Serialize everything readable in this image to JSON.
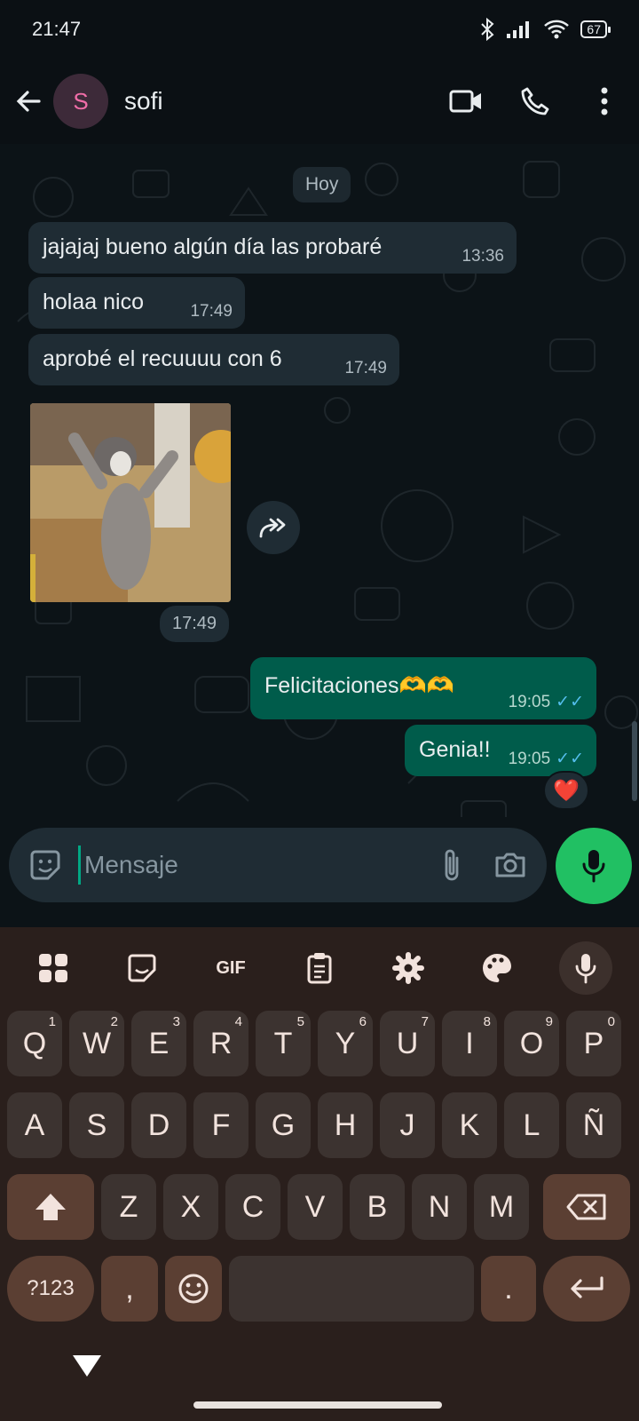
{
  "status": {
    "time": "21:47",
    "battery": "67"
  },
  "header": {
    "avatar_letter": "S",
    "contact_name": "sofi"
  },
  "chat": {
    "date_chip": "Hoy",
    "messages": [
      {
        "text": "jajajaj bueno algún día las probaré",
        "time": "13:36",
        "direction": "in"
      },
      {
        "text": "holaa nico",
        "time": "17:49",
        "direction": "in"
      },
      {
        "text": "aprobé el recuuuu con 6",
        "time": "17:49",
        "direction": "in"
      },
      {
        "type": "gif",
        "time": "17:49",
        "direction": "in"
      },
      {
        "text": "Felicitaciones🫶🫶",
        "time": "19:05",
        "direction": "out",
        "status": "read"
      },
      {
        "text": "Genia!!",
        "time": "19:05",
        "direction": "out",
        "status": "read",
        "reaction": "❤️"
      }
    ]
  },
  "composer": {
    "placeholder": "Mensaje"
  },
  "keyboard": {
    "toolbar": [
      "apps-icon",
      "sticker-icon",
      "GIF",
      "clipboard-icon",
      "settings-icon",
      "palette-icon",
      "mic-icon"
    ],
    "gif_label": "GIF",
    "row1": [
      "Q",
      "W",
      "E",
      "R",
      "T",
      "Y",
      "U",
      "I",
      "O",
      "P"
    ],
    "row1_hints": [
      "1",
      "2",
      "3",
      "4",
      "5",
      "6",
      "7",
      "8",
      "9",
      "0"
    ],
    "row2": [
      "A",
      "S",
      "D",
      "F",
      "G",
      "H",
      "J",
      "K",
      "L",
      "Ñ"
    ],
    "row3": [
      "Z",
      "X",
      "C",
      "V",
      "B",
      "N",
      "M"
    ],
    "symbols_key": "?123",
    "comma": ",",
    "period": "."
  },
  "colors": {
    "accent": "#21c063",
    "outgoing_bubble": "#005c4b",
    "incoming_bubble": "#1f2c34",
    "read_ticks": "#53bdeb"
  }
}
